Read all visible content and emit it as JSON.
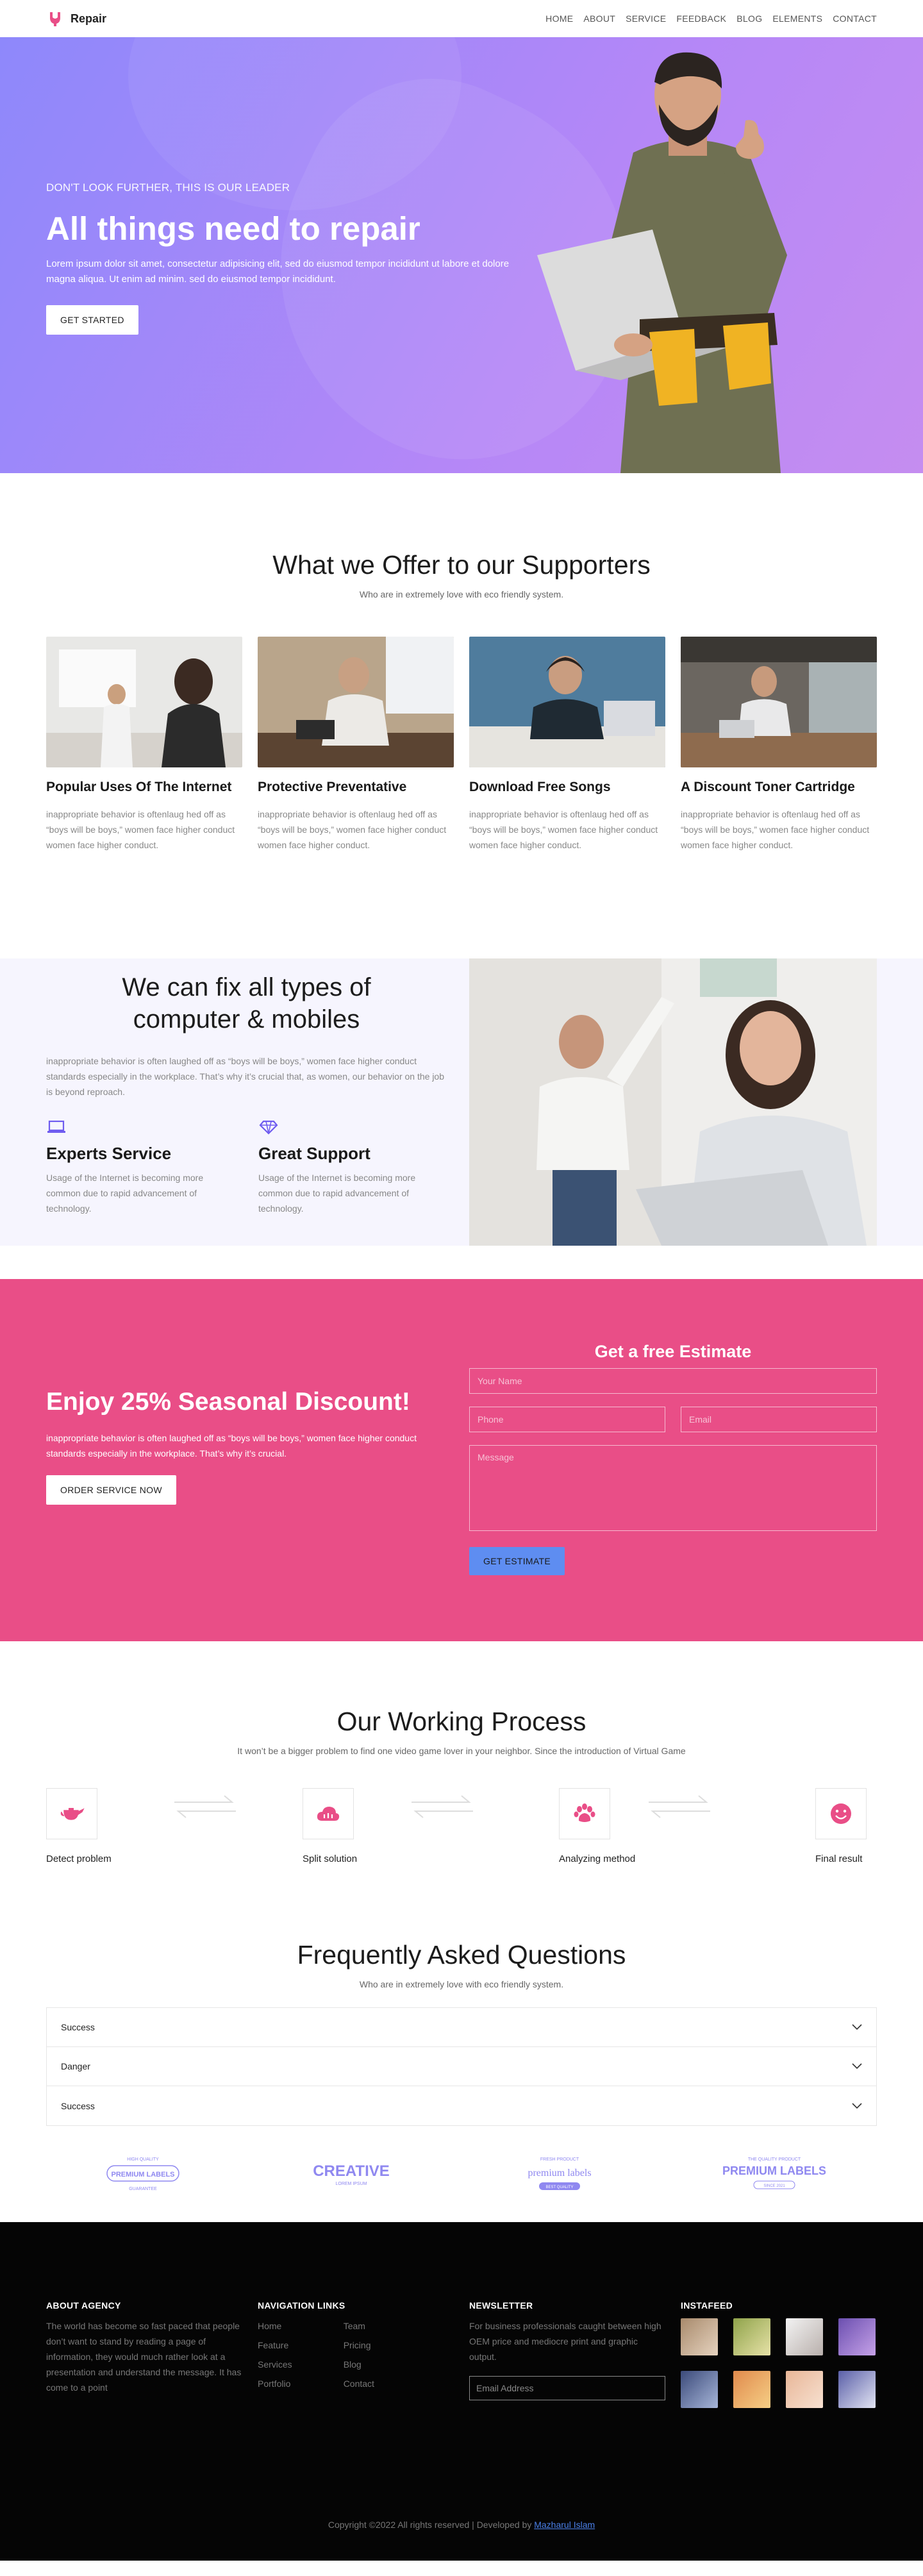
{
  "nav": {
    "brand": "Repair",
    "items": [
      "HOME",
      "ABOUT",
      "SERVICE",
      "FEEDBACK",
      "BLOG",
      "ELEMENTS",
      "CONTACT"
    ]
  },
  "hero": {
    "pretitle": "DON'T LOOK FURTHER, THIS IS OUR LEADER",
    "title": "All things need to repair",
    "desc": "Lorem ipsum dolor sit amet, consectetur adipisicing elit, sed do eiusmod tempor incididunt ut labore et dolore magna aliqua. Ut enim ad minim. sed do eiusmod tempor incididunt.",
    "button": "GET STARTED"
  },
  "offer": {
    "title": "What we Offer to our Supporters",
    "subtitle": "Who are in extremely love with eco friendly system.",
    "cards": [
      {
        "title": "Popular Uses Of The Internet",
        "text": "inappropriate behavior is oftenlaug hed off as “boys will be boys,” women face higher conduct women face higher conduct."
      },
      {
        "title": "Protective Preventative",
        "text": "inappropriate behavior is oftenlaug hed off as “boys will be boys,” women face higher conduct women face higher conduct."
      },
      {
        "title": "Download Free Songs",
        "text": "inappropriate behavior is oftenlaug hed off as “boys will be boys,” women face higher conduct women face higher conduct."
      },
      {
        "title": "A Discount Toner Cartridge",
        "text": "inappropriate behavior is oftenlaug hed off as “boys will be boys,” women face higher conduct women face higher conduct."
      }
    ]
  },
  "fix": {
    "title_line1": "We can fix all types of",
    "title_line2": "computer & mobiles",
    "desc": "inappropriate behavior is often laughed off as “boys will be boys,” women face higher conduct standards especially in the workplace. That’s why it’s crucial that, as women, our behavior on the job is beyond reproach.",
    "features": [
      {
        "icon": "laptop-icon",
        "title": "Experts Service",
        "text": "Usage of the Internet is becoming more common due to rapid advancement of technology."
      },
      {
        "icon": "diamond-icon",
        "title": "Great Support",
        "text": "Usage of the Internet is becoming more common due to rapid advancement of technology."
      }
    ]
  },
  "estimate": {
    "title": "Enjoy 25% Seasonal Discount!",
    "desc": "inappropriate behavior is often laughed off as “boys will be boys,” women face higher conduct standards especially in the workplace. That’s why it’s crucial.",
    "order_button": "ORDER SERVICE NOW",
    "form_title": "Get a free Estimate",
    "name_placeholder": "Your Name",
    "phone_placeholder": "Phone",
    "email_placeholder": "Email",
    "message_placeholder": "Message",
    "submit": "GET ESTIMATE"
  },
  "process": {
    "title": "Our Working Process",
    "subtitle": "It won’t be a bigger problem to find one video game lover in your neighbor. Since the introduction of Virtual Game",
    "steps": [
      {
        "icon": "teapot-icon",
        "label": "Detect problem"
      },
      {
        "icon": "cloud-upload-icon",
        "label": "Split solution"
      },
      {
        "icon": "paw-icon",
        "label": "Analyzing method"
      },
      {
        "icon": "smile-icon",
        "label": "Final result"
      }
    ],
    "accent": "#e94e87"
  },
  "faq": {
    "title": "Frequently Asked Questions",
    "subtitle": "Who are in extremely love with eco friendly system.",
    "items": [
      "Success",
      "Danger",
      "Success"
    ]
  },
  "brand_logos": [
    {
      "top": "HIGH QUALITY",
      "main": "PREMIUM LABELS",
      "bottom": "GUARANTEE"
    },
    {
      "top": "",
      "main": "CREATIVE",
      "bottom": "LOREM IPSUM"
    },
    {
      "top": "FRESH PRODUCT",
      "main": "premium labels",
      "bottom": "BEST QUALITY"
    },
    {
      "top": "THE QUALITY PRODUCT",
      "main": "PREMIUM LABELS",
      "bottom": "SINCE 2021"
    }
  ],
  "footer": {
    "about_head": "ABOUT AGENCY",
    "about_text": "The world has become so fast paced that people don’t want to stand by reading a page of information, they would much rather look at a presentation and understand the message. It has come to a point",
    "nav_head": "NAVIGATION LINKS",
    "links_col1": [
      "Home",
      "Feature",
      "Services",
      "Portfolio"
    ],
    "links_col2": [
      "Team",
      "Pricing",
      "Blog",
      "Contact"
    ],
    "news_head": "NEWSLETTER",
    "news_text": "For business professionals caught between high OEM price and mediocre print and graphic output.",
    "news_placeholder": "Email Address",
    "insta_head": "INSTAFEED",
    "copyright": "Copyright ©2022 All rights reserved | Developed by",
    "developer": "Mazharul Islam"
  }
}
